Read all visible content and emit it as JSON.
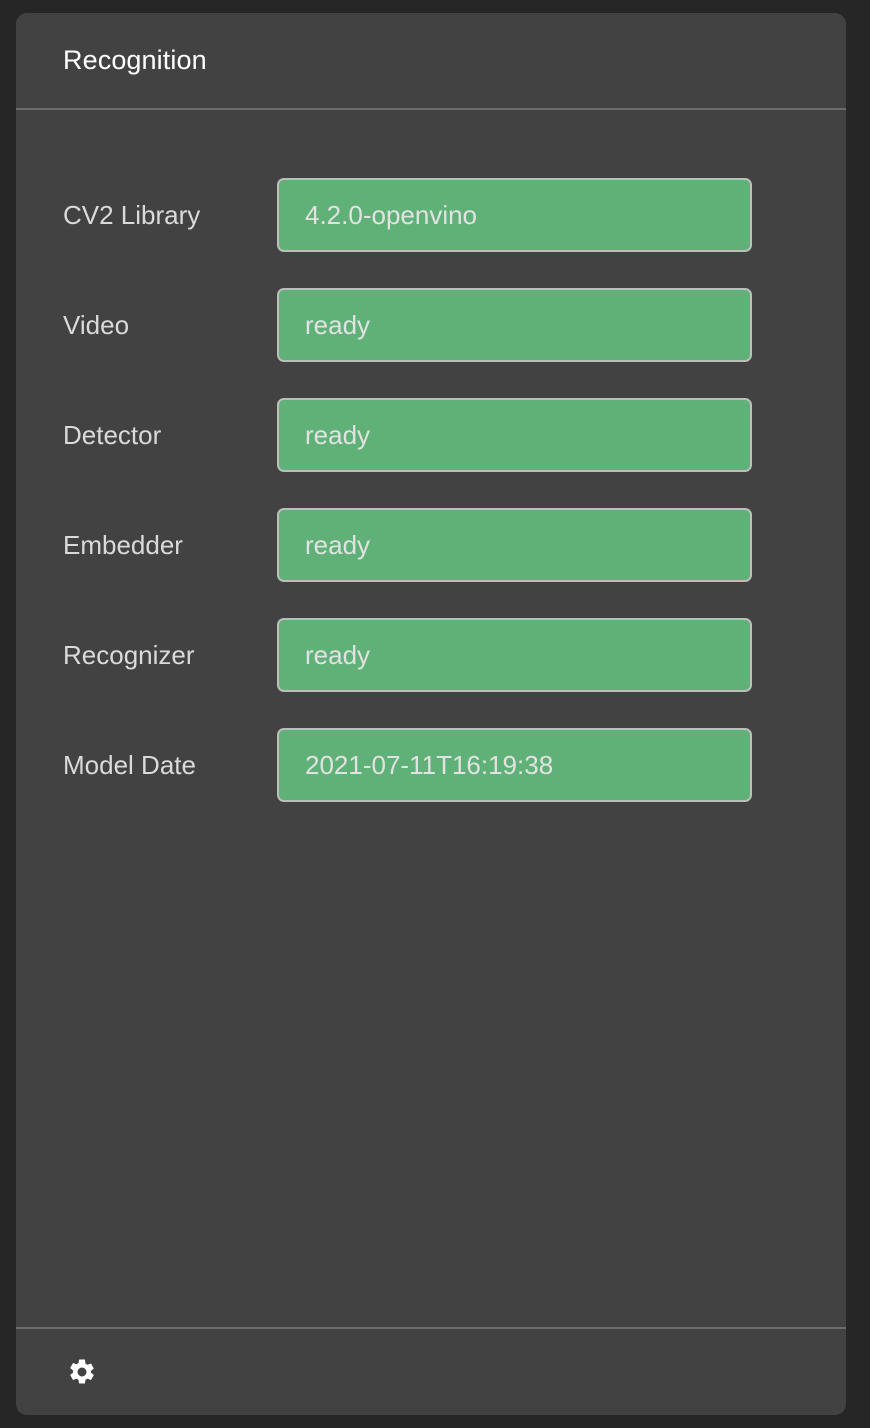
{
  "panel": {
    "title": "Recognition",
    "rows": [
      {
        "label": "CV2 Library",
        "value": "4.2.0-openvino"
      },
      {
        "label": "Video",
        "value": "ready"
      },
      {
        "label": "Detector",
        "value": "ready"
      },
      {
        "label": "Embedder",
        "value": "ready"
      },
      {
        "label": "Recognizer",
        "value": "ready"
      },
      {
        "label": "Model Date",
        "value": "2021-07-11T16:19:38"
      }
    ],
    "footer": {
      "settings_icon": "gear-icon"
    }
  },
  "colors": {
    "page_background": "#262626",
    "panel_background": "#424242",
    "status_ok": "#5fb177",
    "status_border": "#bdbdbd",
    "divider": "#6c6c6c",
    "title_text": "#ffffff",
    "label_text": "#dadada",
    "value_text": "#e2e2e2"
  }
}
